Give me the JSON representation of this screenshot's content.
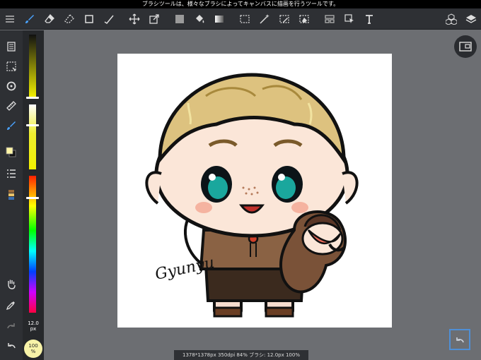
{
  "status_bar": {
    "tool_hint": "ブラシツールは、様々なブラシによってキャンバスに描画を行うツールです。"
  },
  "toolbar": {
    "items": [
      "menu-icon",
      "brush-icon",
      "eraser-icon",
      "blur-icon",
      "rect-icon",
      "select-pen-icon",
      "move-icon",
      "transform-icon",
      "fill-color-icon",
      "bucket-icon",
      "gradient-icon",
      "rect-select-icon",
      "magic-wand-icon",
      "select-pen-icon",
      "select-eraser-icon",
      "panel-icon",
      "select-move-icon",
      "text-icon",
      "materials-icon",
      "layers-icon"
    ]
  },
  "sliders": {
    "brush_size": "12.0",
    "brush_size_unit": "px",
    "zoom": "100",
    "zoom_unit": "%"
  },
  "colors": {
    "accent": "#4f8fd6",
    "primary": "#fff6a6",
    "secondary": "#111111"
  },
  "footer": {
    "info": "1378*1378px 350dpi 84% ブラシ: 12.0px 100%"
  },
  "artwork": {
    "signature": "Gyunyu"
  }
}
